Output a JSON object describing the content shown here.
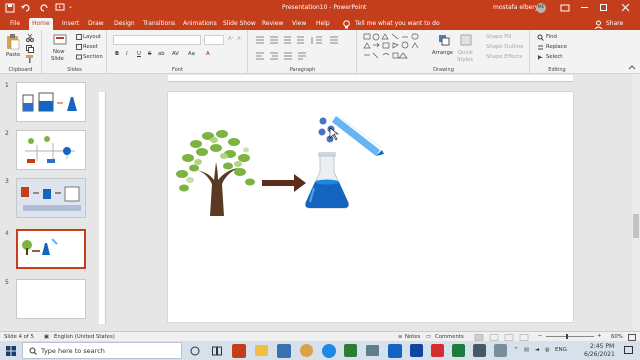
{
  "titlebar": {
    "doc_title": "Presentation10",
    "app_sep": " - ",
    "app_name": "PowerPoint",
    "user": "mostafa elbery",
    "initials": "ME"
  },
  "tabs": [
    "File",
    "Home",
    "Insert",
    "Draw",
    "Design",
    "Transitions",
    "Animations",
    "Slide Show",
    "Review",
    "View",
    "Help"
  ],
  "active_tab": "Home",
  "search_text": "Tell me what you want to do",
  "share_label": "Share",
  "ribbon": {
    "clipboard": {
      "paste": "Paste",
      "label": "Clipboard"
    },
    "slides": {
      "new_slide": "New",
      "new_slide2": "Slide",
      "layout": "Layout",
      "reset": "Reset",
      "section": "Section",
      "label": "Slides"
    },
    "font": {
      "label": "Font",
      "bold": "B",
      "italic": "I",
      "underline": "U",
      "strike": "S",
      "shadow": "ab",
      "spacing": "AV",
      "case": "Aa",
      "color": "A"
    },
    "paragraph": {
      "label": "Paragraph"
    },
    "drawing": {
      "label": "Drawing",
      "arrange": "Arrange",
      "quick_styles": "Quick",
      "quick_styles2": "Styles",
      "shape_fill": "Shape Fill",
      "shape_outline": "Shape Outline",
      "shape_effects": "Shape Effects"
    },
    "editing": {
      "label": "Editing",
      "find": "Find",
      "replace": "Replace",
      "select": "Select"
    }
  },
  "slides": [
    {
      "num": "1"
    },
    {
      "num": "2"
    },
    {
      "num": "3"
    },
    {
      "num": "4"
    },
    {
      "num": "5"
    }
  ],
  "selected_slide": 4,
  "status": {
    "slide_info": "Slide 4 of 5",
    "language": "English (United States)",
    "notes": "Notes",
    "comments": "Comments",
    "zoom": "60%"
  },
  "taskbar": {
    "search_placeholder": "Type here to search",
    "time": "2:45 PM",
    "date": "6/26/2021",
    "lang": "ENG"
  },
  "colors": {
    "accent": "#c43e1c",
    "tree_trunk": "#5a3a22",
    "arrow": "#5a2e1a",
    "flask_blue": "#1565c0"
  }
}
